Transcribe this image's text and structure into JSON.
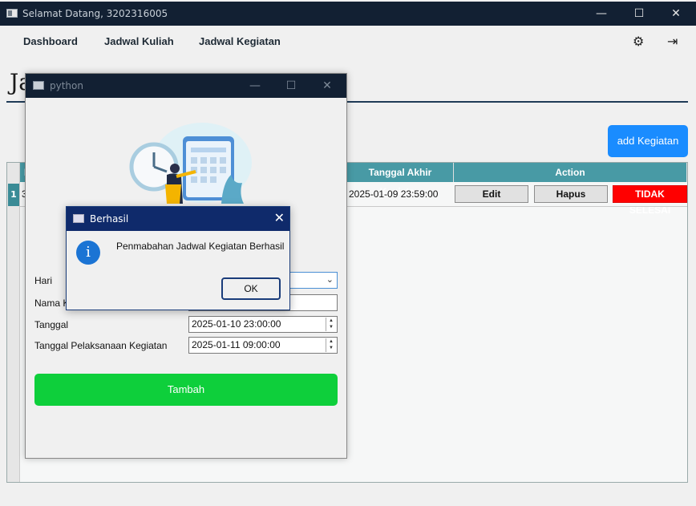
{
  "main_window": {
    "title": "Selamat Datang, 3202316005",
    "minimize": "—",
    "maximize": "☐",
    "close": "✕"
  },
  "nav": {
    "items": [
      "Dashboard",
      "Jadwal Kuliah",
      "Jadwal Kegiatan"
    ],
    "settings_icon": "gear-icon",
    "logout_icon": "logout-icon"
  },
  "page": {
    "title": "Ja",
    "add_button": "add Kegiatan"
  },
  "table": {
    "headers": {
      "col1": "I",
      "tanggal_akhir": "Tanggal Akhir Kegiatan",
      "action": "Action"
    },
    "rows": [
      {
        "row_num": "1",
        "col1": "3",
        "tanggal_akhir": "2025-01-09 23:59:00",
        "edit": "Edit",
        "hapus": "Hapus",
        "status": "TIDAK SELESAI"
      }
    ]
  },
  "python_dialog": {
    "title": "python",
    "minimize": "—",
    "maximize": "☐",
    "close": "✕",
    "form": {
      "hari_label": "Hari",
      "nama_label": "Nama K",
      "tanggal_label": "Tanggal",
      "tanggal_value": "2025-01-10 23:00:00",
      "pelaksanaan_label": "Tanggal Pelaksanaan Kegiatan",
      "pelaksanaan_value": "2025-01-11 09:00:00"
    },
    "tambah_button": "Tambah"
  },
  "message_box": {
    "title": "Berhasil",
    "close": "✕",
    "icon": "i",
    "message": "Penmabahan Jadwal Kegiatan Berhasil",
    "ok_button": "OK"
  },
  "colors": {
    "titlebar": "#122033",
    "table_header": "#489aa5",
    "add_button": "#1a8cff",
    "tambah_button": "#0ecf3b",
    "status_red": "#ff0000",
    "msg_titlebar": "#0f2a6b"
  }
}
